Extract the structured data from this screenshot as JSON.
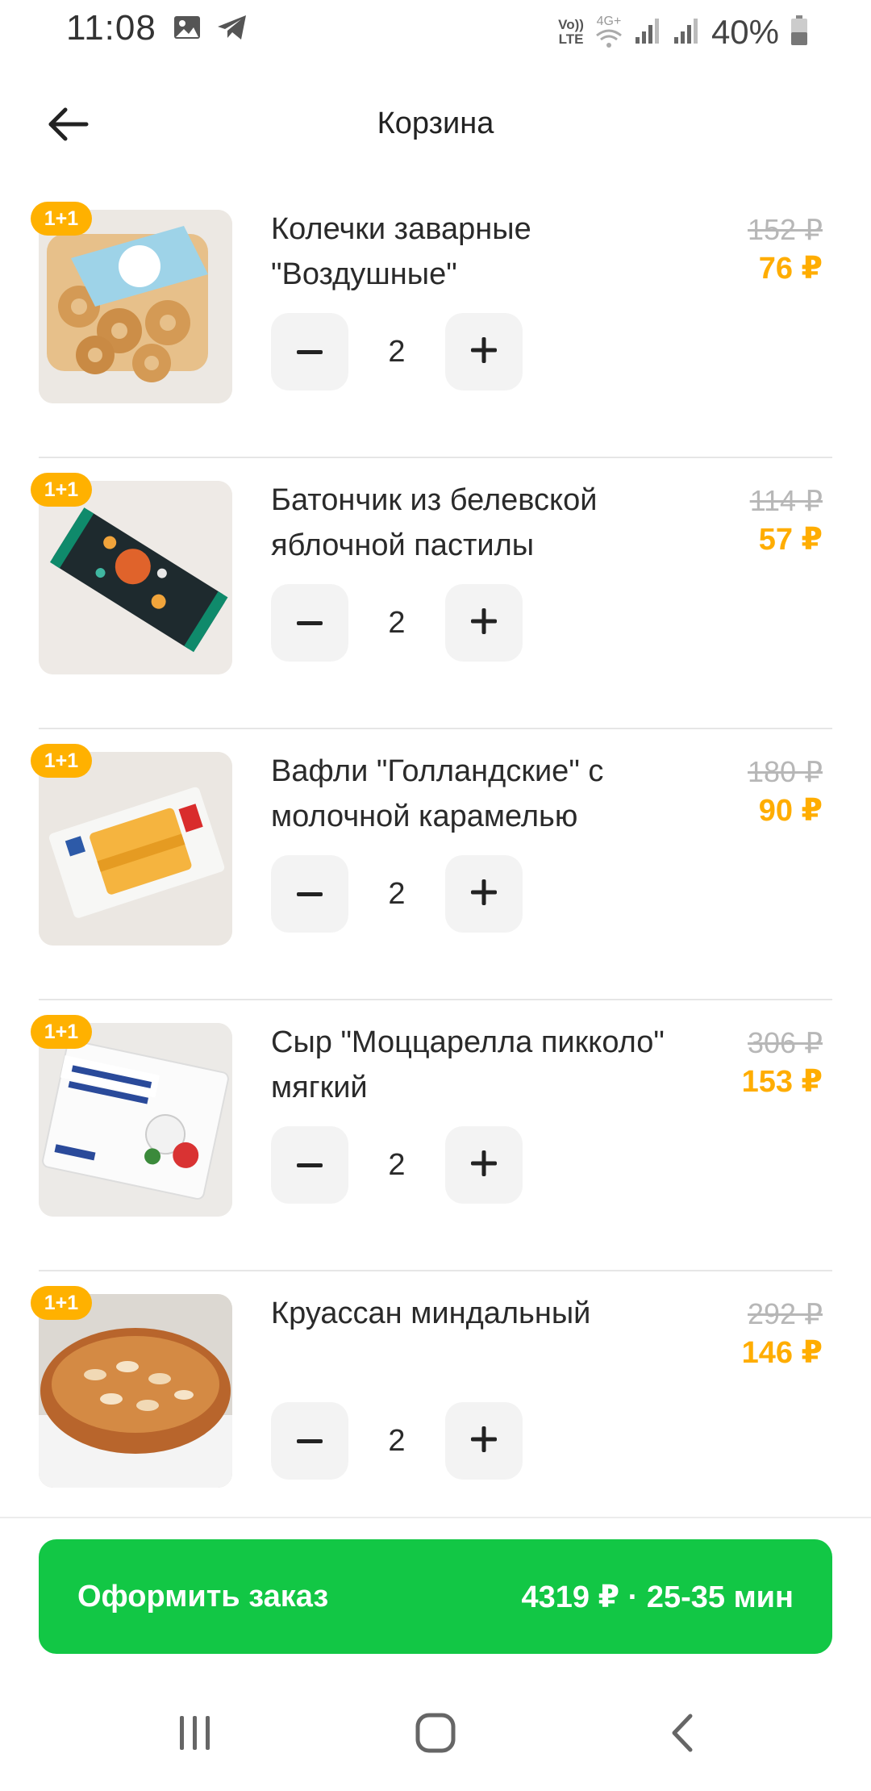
{
  "status_bar": {
    "time": "11:08",
    "battery": "40%",
    "icons": [
      "image-icon",
      "telegram-icon",
      "volte-icon",
      "wifi-icon",
      "signal-icon",
      "signal-icon",
      "battery-icon"
    ],
    "volte_label_top": "Vo))",
    "volte_label_bottom": "LTE",
    "net_label": "4G+"
  },
  "header": {
    "title": "Корзина",
    "back_icon": "arrow-left-icon"
  },
  "cart": {
    "items": [
      {
        "badge": "1+1",
        "name": "Колечки заварные \"Воздушные\"",
        "quantity": "2",
        "old_price": "152 ₽",
        "new_price": "76 ₽"
      },
      {
        "badge": "1+1",
        "name": "Батончик из белевской яблочной пастилы",
        "quantity": "2",
        "old_price": "114 ₽",
        "new_price": "57 ₽"
      },
      {
        "badge": "1+1",
        "name": "Вафли \"Голландские\" с молочной карамелью",
        "quantity": "2",
        "old_price": "180 ₽",
        "new_price": "90 ₽"
      },
      {
        "badge": "1+1",
        "name": "Сыр \"Моццарелла пикколо\" мягкий",
        "quantity": "2",
        "old_price": "306 ₽",
        "new_price": "153 ₽"
      },
      {
        "badge": "1+1",
        "name": "Круассан миндальный",
        "quantity": "2",
        "old_price": "292 ₽",
        "new_price": "146 ₽"
      }
    ]
  },
  "checkout": {
    "label": "Оформить заказ",
    "summary": "4319 ₽ · 25-35 мин"
  },
  "nav": {
    "recents_icon": "recents-icon",
    "home_icon": "home-icon",
    "back_icon": "back-chevron-icon"
  },
  "colors": {
    "accent_green": "#12c745",
    "price_orange": "#ffad00",
    "badge_orange": "#ffb100"
  }
}
